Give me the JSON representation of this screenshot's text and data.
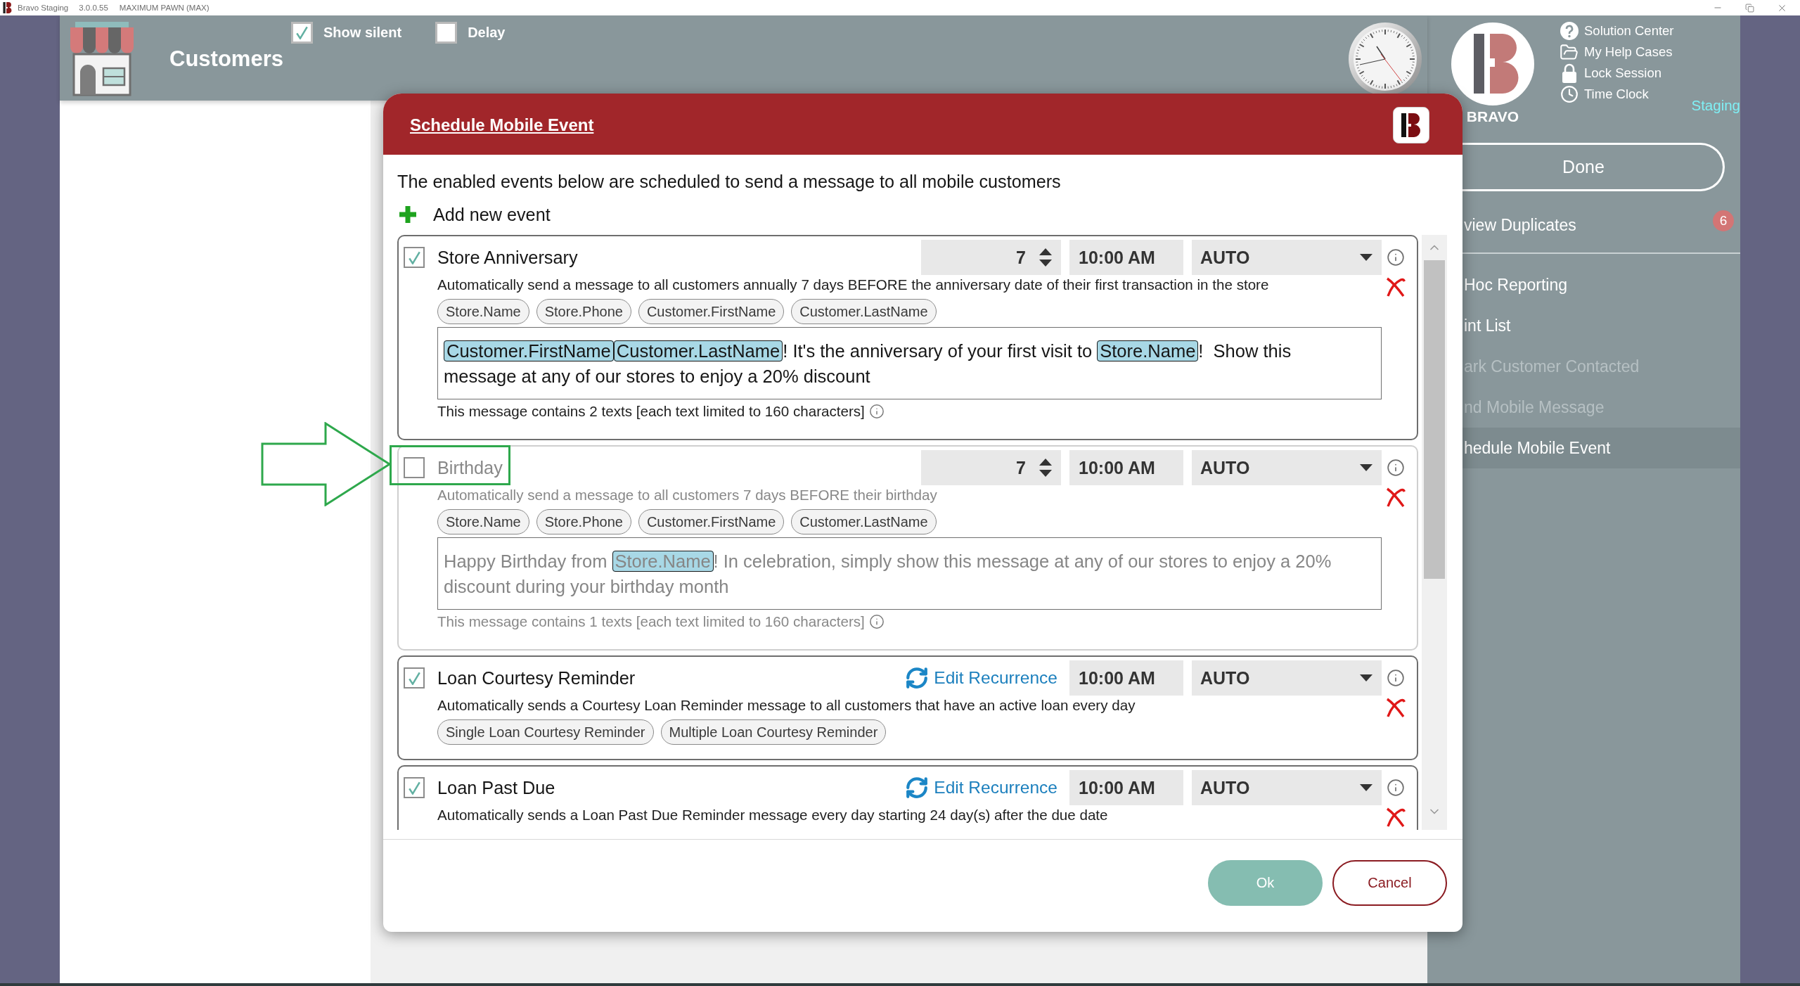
{
  "title_bar": {
    "app_name": "Bravo Staging",
    "version": "3.0.0.55",
    "store": "MAXIMUM PAWN (MAX)"
  },
  "header": {
    "title": "Customers",
    "toggles": [
      {
        "label": "Show silent",
        "checked": true
      },
      {
        "label": "Delay",
        "checked": false
      }
    ],
    "logo_caption": "BRAVO",
    "links": [
      {
        "kind": "help",
        "label": "Solution Center"
      },
      {
        "kind": "cases",
        "label": "My Help Cases"
      },
      {
        "kind": "lock",
        "label": "Lock Session"
      },
      {
        "kind": "clock",
        "label": "Time Clock"
      }
    ],
    "environment": "Staging"
  },
  "sidebar": {
    "done_button": "Done",
    "groups": [
      {
        "items": [
          {
            "label": "view Duplicates",
            "badge": "6",
            "disabled": false,
            "selected": false
          }
        ]
      },
      {
        "items": [
          {
            "label": "Hoc Reporting",
            "disabled": false,
            "selected": false
          },
          {
            "label": "int List",
            "disabled": false,
            "selected": false
          },
          {
            "label": "ark Customer Contacted",
            "disabled": true,
            "selected": false
          },
          {
            "label": "nd Mobile Message",
            "disabled": true,
            "selected": false
          },
          {
            "label": "hedule Mobile Event",
            "disabled": false,
            "selected": true
          }
        ]
      }
    ]
  },
  "dialog": {
    "title": "Schedule Mobile Event",
    "intro": "The enabled events below are scheduled to send a message to all mobile customers",
    "add_button": "Add new event",
    "events": [
      {
        "kind": "days",
        "checked": true,
        "title": "Store Anniversary",
        "days": "7",
        "time": "10:00 AM",
        "mode": "AUTO",
        "description": "Automatically send a message to all customers annually 7 days BEFORE the anniversary date of their first transaction in the store",
        "tags": [
          "Store.Name",
          "Store.Phone",
          "Customer.FirstName",
          "Customer.LastName"
        ],
        "message": [
          {
            "kind": "token",
            "text": "Customer.FirstName"
          },
          {
            "kind": "token",
            "text": "Customer.LastName"
          },
          {
            "kind": "text",
            "text": "! It's the anniversary of your first visit to "
          },
          {
            "kind": "token",
            "text": "Store.Name"
          },
          {
            "kind": "text",
            "text": "!  Show this message at any of our stores to enjoy a 20% discount"
          }
        ],
        "note": "This message contains 2 texts [each text limited to 160 characters]"
      },
      {
        "kind": "days",
        "checked": false,
        "title": "Birthday",
        "days": "7",
        "time": "10:00 AM",
        "mode": "AUTO",
        "description": "Automatically send a message to all customers 7 days BEFORE their birthday",
        "tags": [
          "Store.Name",
          "Store.Phone",
          "Customer.FirstName",
          "Customer.LastName"
        ],
        "message": [
          {
            "kind": "text",
            "text": "Happy Birthday from "
          },
          {
            "kind": "token",
            "text": "Store.Name"
          },
          {
            "kind": "text",
            "text": "! In celebration, simply show this message at any of our stores to enjoy a 20% discount during your birthday month"
          }
        ],
        "note": "This message contains 1 texts [each text limited to 160 characters]"
      },
      {
        "kind": "recurrence",
        "checked": true,
        "title": "Loan Courtesy Reminder",
        "link": "Edit Recurrence",
        "time": "10:00 AM",
        "mode": "AUTO",
        "description": "Automatically sends a Courtesy Loan Reminder message to all customers that have an active loan every day",
        "tags": [
          "Single Loan Courtesy Reminder",
          "Multiple Loan Courtesy Reminder"
        ]
      },
      {
        "kind": "recurrence",
        "checked": true,
        "title": "Loan Past Due",
        "link": "Edit Recurrence",
        "time": "10:00 AM",
        "mode": "AUTO",
        "description": "Automatically sends a Loan Past Due Reminder message every day starting 24 day(s) after the due date"
      }
    ],
    "buttons": [
      {
        "kind": "primary",
        "label": "Ok"
      },
      {
        "kind": "secondary",
        "label": "Cancel"
      }
    ]
  }
}
